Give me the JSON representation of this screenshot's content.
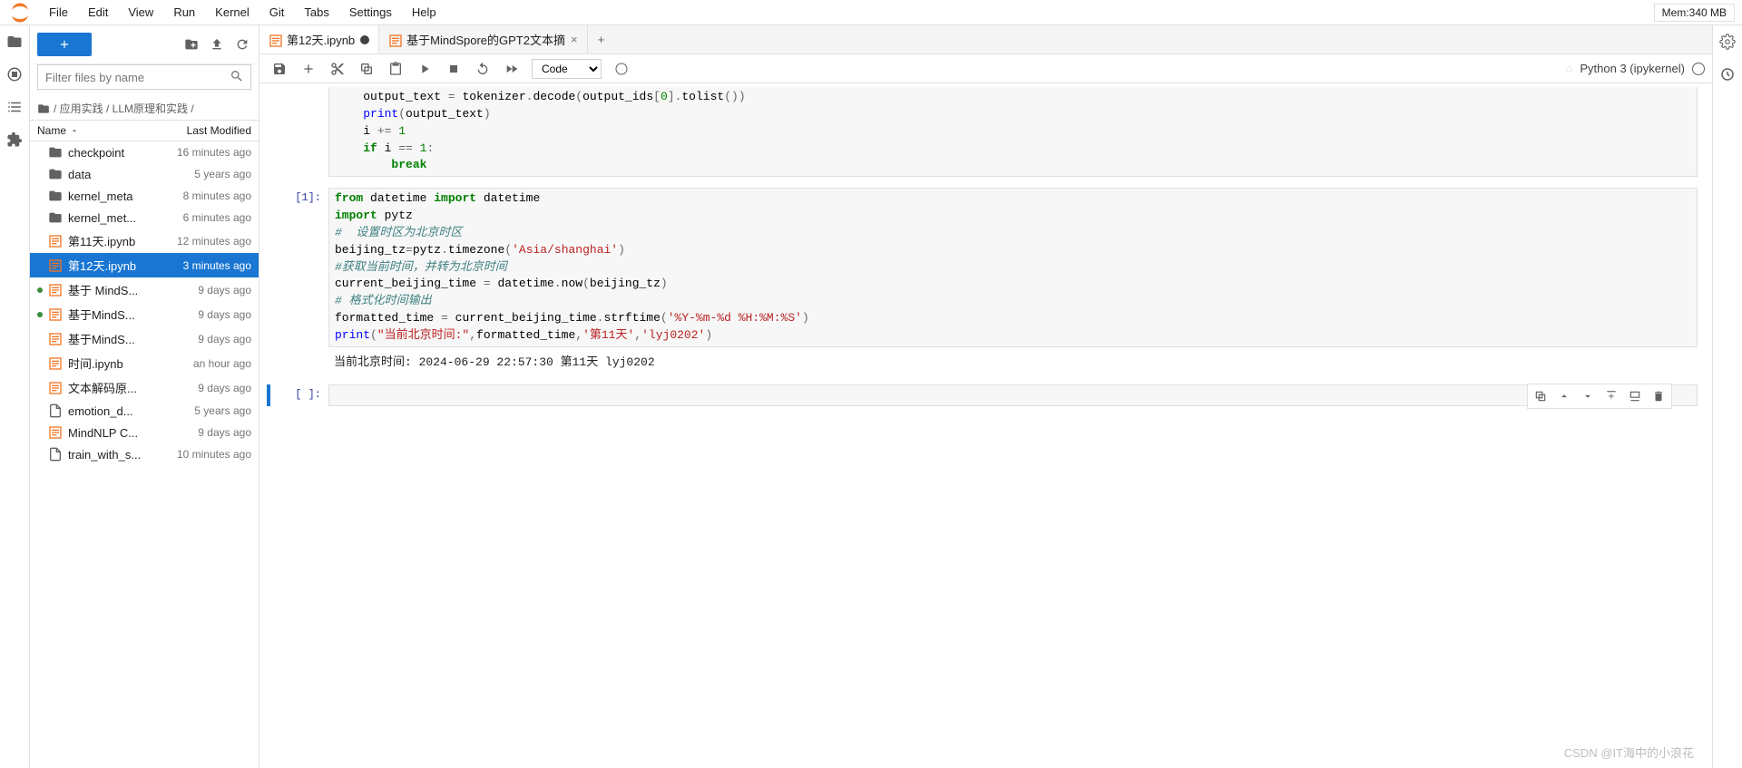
{
  "menu": [
    "File",
    "Edit",
    "View",
    "Run",
    "Kernel",
    "Git",
    "Tabs",
    "Settings",
    "Help"
  ],
  "memory": "Mem:340 MB",
  "filter_placeholder": "Filter files by name",
  "breadcrumb": [
    "",
    "应用实践",
    "LLM原理和实践",
    ""
  ],
  "file_cols": {
    "name": "Name",
    "modified": "Last Modified"
  },
  "files": [
    {
      "icon": "folder",
      "name": "checkpoint",
      "mod": "16 minutes ago",
      "running": false
    },
    {
      "icon": "folder",
      "name": "data",
      "mod": "5 years ago",
      "running": false
    },
    {
      "icon": "folder",
      "name": "kernel_meta",
      "mod": "8 minutes ago",
      "running": false
    },
    {
      "icon": "folder",
      "name": "kernel_met...",
      "mod": "6 minutes ago",
      "running": false
    },
    {
      "icon": "nb",
      "name": "第11天.ipynb",
      "mod": "12 minutes ago",
      "running": false
    },
    {
      "icon": "nb",
      "name": "第12天.ipynb",
      "mod": "3 minutes ago",
      "running": false,
      "selected": true
    },
    {
      "icon": "nb",
      "name": "基于 MindS...",
      "mod": "9 days ago",
      "running": true
    },
    {
      "icon": "nb",
      "name": "基于MindS...",
      "mod": "9 days ago",
      "running": true
    },
    {
      "icon": "nb",
      "name": "基于MindS...",
      "mod": "9 days ago",
      "running": false
    },
    {
      "icon": "nb",
      "name": "时间.ipynb",
      "mod": "an hour ago",
      "running": false
    },
    {
      "icon": "nb",
      "name": "文本解码原...",
      "mod": "9 days ago",
      "running": false
    },
    {
      "icon": "txt",
      "name": "emotion_d...",
      "mod": "5 years ago",
      "running": false
    },
    {
      "icon": "nb",
      "name": "MindNLP C...",
      "mod": "9 days ago",
      "running": false
    },
    {
      "icon": "txt",
      "name": "train_with_s...",
      "mod": "10 minutes ago",
      "running": false
    }
  ],
  "tabs": [
    {
      "label": "第12天.ipynb",
      "dirty": true,
      "active": true
    },
    {
      "label": "基于MindSpore的GPT2文本摘",
      "dirty": false,
      "active": false
    }
  ],
  "cell_type": "Code",
  "kernel": "Python 3 (ipykernel)",
  "cells": {
    "partial_lines": [
      {
        "indent": 2,
        "tokens": [
          [
            "nm",
            "output_text "
          ],
          [
            "op",
            "= "
          ],
          [
            "nm",
            "tokenizer"
          ],
          [
            "op",
            "."
          ],
          [
            "nm",
            "decode"
          ],
          [
            "op",
            "("
          ],
          [
            "nm",
            "output_ids"
          ],
          [
            "op",
            "["
          ],
          [
            "num",
            "0"
          ],
          [
            "op",
            "]"
          ],
          [
            "op",
            "."
          ],
          [
            "nm",
            "tolist"
          ],
          [
            "op",
            "("
          ],
          [
            "op",
            ")"
          ],
          [
            "op",
            ")"
          ]
        ]
      },
      {
        "indent": 2,
        "tokens": [
          [
            "fn",
            "print"
          ],
          [
            "op",
            "("
          ],
          [
            "nm",
            "output_text"
          ],
          [
            "op",
            ")"
          ]
        ]
      },
      {
        "indent": 2,
        "tokens": [
          [
            "nm",
            "i "
          ],
          [
            "op",
            "+= "
          ],
          [
            "num",
            "1"
          ]
        ]
      },
      {
        "indent": 2,
        "tokens": [
          [
            "kw",
            "if"
          ],
          [
            "nm",
            " i "
          ],
          [
            "op",
            "== "
          ],
          [
            "num",
            "1"
          ],
          [
            "op",
            ":"
          ]
        ]
      },
      {
        "indent": 4,
        "tokens": [
          [
            "kw",
            "break"
          ]
        ]
      }
    ],
    "cell1_prompt": "[1]:",
    "cell1_lines": [
      {
        "indent": 0,
        "tokens": [
          [
            "kw",
            "from"
          ],
          [
            "nm",
            " datetime "
          ],
          [
            "kw",
            "import"
          ],
          [
            "nm",
            " datetime"
          ]
        ]
      },
      {
        "indent": 0,
        "tokens": [
          [
            "kw",
            "import"
          ],
          [
            "nm",
            " pytz"
          ]
        ]
      },
      {
        "indent": 0,
        "tokens": [
          [
            "com",
            "#  设置时区为北京时区"
          ]
        ]
      },
      {
        "indent": 0,
        "tokens": [
          [
            "nm",
            "beijing_tz"
          ],
          [
            "op",
            "="
          ],
          [
            "nm",
            "pytz"
          ],
          [
            "op",
            "."
          ],
          [
            "nm",
            "timezone"
          ],
          [
            "op",
            "("
          ],
          [
            "str",
            "'Asia/shanghai'"
          ],
          [
            "op",
            ")"
          ]
        ]
      },
      {
        "indent": 0,
        "tokens": [
          [
            "com",
            "#获取当前时间，并转为北京时间"
          ]
        ]
      },
      {
        "indent": 0,
        "tokens": [
          [
            "nm",
            "current_beijing_time "
          ],
          [
            "op",
            "= "
          ],
          [
            "nm",
            "datetime"
          ],
          [
            "op",
            "."
          ],
          [
            "nm",
            "now"
          ],
          [
            "op",
            "("
          ],
          [
            "nm",
            "beijing_tz"
          ],
          [
            "op",
            ")"
          ]
        ]
      },
      {
        "indent": 0,
        "tokens": [
          [
            "com",
            "# 格式化时间输出"
          ]
        ]
      },
      {
        "indent": 0,
        "tokens": [
          [
            "nm",
            "formatted_time "
          ],
          [
            "op",
            "= "
          ],
          [
            "nm",
            "current_beijing_time"
          ],
          [
            "op",
            "."
          ],
          [
            "nm",
            "strftime"
          ],
          [
            "op",
            "("
          ],
          [
            "str",
            "'%Y-%m-%d %H:%M:%S'"
          ],
          [
            "op",
            ")"
          ]
        ]
      },
      {
        "indent": 0,
        "tokens": [
          [
            "fn",
            "print"
          ],
          [
            "op",
            "("
          ],
          [
            "str",
            "\"当前北京时间:\""
          ],
          [
            "op",
            ","
          ],
          [
            "nm",
            "formatted_time"
          ],
          [
            "op",
            ","
          ],
          [
            "str",
            "'第11天'"
          ],
          [
            "op",
            ","
          ],
          [
            "str",
            "'lyj0202'"
          ],
          [
            "op",
            ")"
          ]
        ]
      }
    ],
    "output": "当前北京时间: 2024-06-29 22:57:30 第11天 lyj0202",
    "empty_prompt": "[ ]:"
  },
  "watermark": "CSDN @IT海中的小浪花"
}
